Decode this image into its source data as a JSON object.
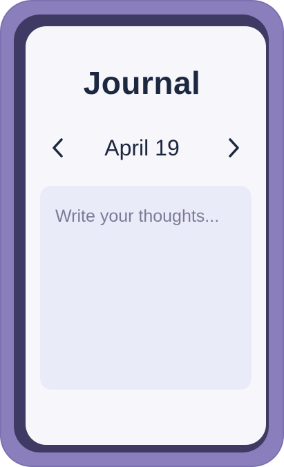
{
  "app": {
    "title": "Journal"
  },
  "date_nav": {
    "current_date": "April 19",
    "prev_icon": "chevron-left-icon",
    "next_icon": "chevron-right-icon"
  },
  "entry": {
    "value": "",
    "placeholder": "Write your thoughts..."
  },
  "colors": {
    "frame_outer": "#8a7fbc",
    "frame_bezel": "#3e3a63",
    "screen_bg": "#f7f7fb",
    "text_primary": "#1c2740",
    "entry_bg": "#eaebf8",
    "placeholder": "#7b7b98"
  }
}
